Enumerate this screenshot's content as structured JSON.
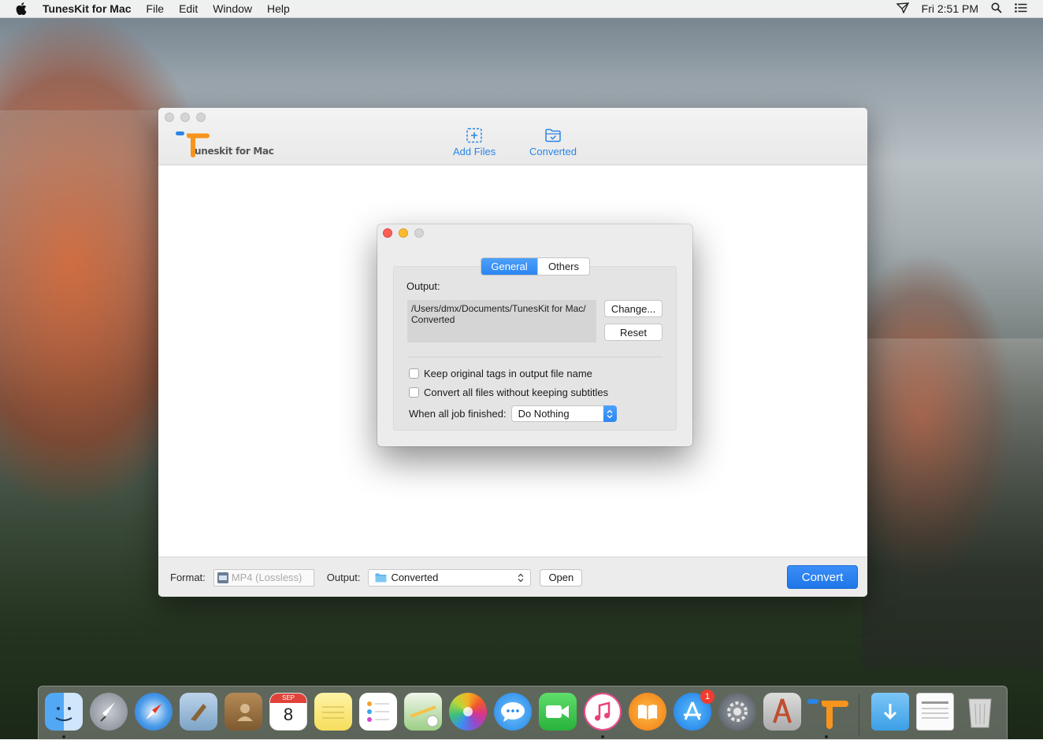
{
  "menubar": {
    "app_name": "TunesKit for Mac",
    "items": [
      "File",
      "Edit",
      "Window",
      "Help"
    ],
    "clock": "Fri 2:51 PM"
  },
  "main_window": {
    "logo_text": "uneskit for Mac",
    "toolbar": {
      "add_files_label": "Add Files",
      "converted_label": "Converted"
    },
    "bottom_bar": {
      "format_label": "Format:",
      "format_value": "MP4 (Lossless)",
      "output_label": "Output:",
      "output_value": "Converted",
      "open_label": "Open",
      "convert_label": "Convert"
    }
  },
  "preferences_dialog": {
    "tabs": [
      "General",
      "Others"
    ],
    "selected_tab": "General",
    "output_label": "Output:",
    "output_path": "/Users/dmx/Documents/TunesKit for Mac/\nConverted",
    "change_label": "Change...",
    "reset_label": "Reset",
    "checkboxes": [
      {
        "label": "Keep original tags in output file name",
        "checked": false
      },
      {
        "label": "Convert all files without keeping subtitles",
        "checked": false
      }
    ],
    "when_finished_label": "When all job finished:",
    "when_finished_value": "Do Nothing"
  },
  "dock": {
    "calendar_month": "SEP",
    "calendar_day": "8",
    "appstore_badge": "1"
  },
  "colors": {
    "accent_blue": "#2a85e8",
    "close_red": "#fc5f57",
    "minimize_yellow": "#fdbc2e",
    "logo_orange": "#f7941d",
    "logo_blue": "#2a85e8"
  }
}
